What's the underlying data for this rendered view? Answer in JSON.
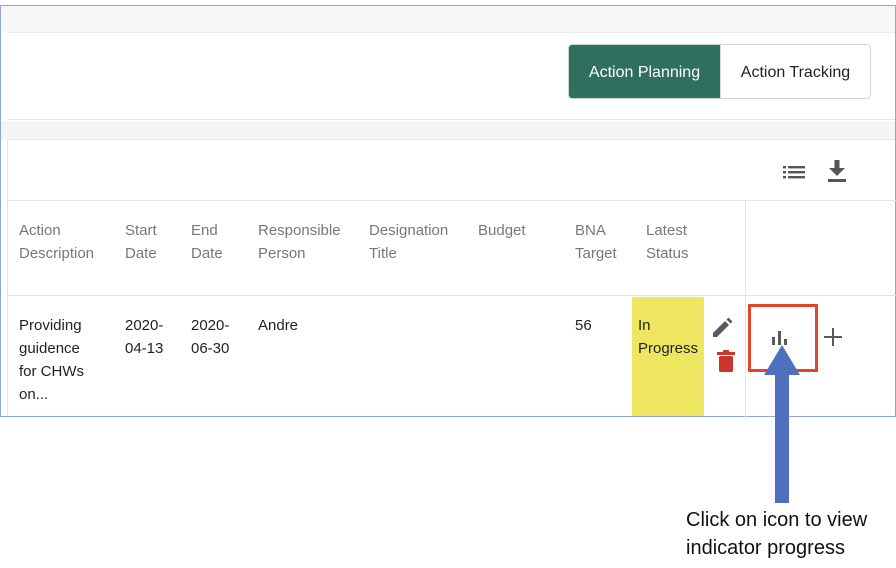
{
  "tabs": {
    "action_planning": "Action Planning",
    "action_tracking": "Action Tracking"
  },
  "toolbar": {
    "list_icon": "list-icon",
    "download_icon": "download-icon"
  },
  "table": {
    "headers": [
      {
        "line1": "Action",
        "line2": "Description"
      },
      {
        "line1": "Start",
        "line2": "Date"
      },
      {
        "line1": "End",
        "line2": "Date"
      },
      {
        "line1": "Responsible",
        "line2": "Person"
      },
      {
        "line1": "Designation",
        "line2": "Title"
      },
      {
        "line1": "Budget",
        "line2": ""
      },
      {
        "line1": "BNA",
        "line2": "Target"
      },
      {
        "line1": "Latest",
        "line2": "Status"
      }
    ],
    "row": {
      "description": [
        "Providing",
        "guidence",
        "for CHWs",
        "on..."
      ],
      "start_date": [
        "2020-",
        "04-13"
      ],
      "end_date": [
        "2020-",
        "06-30"
      ],
      "responsible": "Andre",
      "designation": "",
      "budget": "",
      "bna_target": "56",
      "status": [
        "In",
        "Progress"
      ],
      "status_color": "#eee561"
    },
    "row_actions": {
      "edit_icon": "pencil-icon",
      "delete_icon": "trash-icon",
      "indicator_icon": "bar-chart-icon",
      "add_icon": "plus-icon"
    }
  },
  "annotation": {
    "line1": "Click on icon to view",
    "line2": "indicator progress",
    "highlight_color": "#e0432e",
    "arrow_color": "#4f6fbf"
  },
  "colors": {
    "accent": "#2e6f5e",
    "delete": "#c9372c"
  }
}
